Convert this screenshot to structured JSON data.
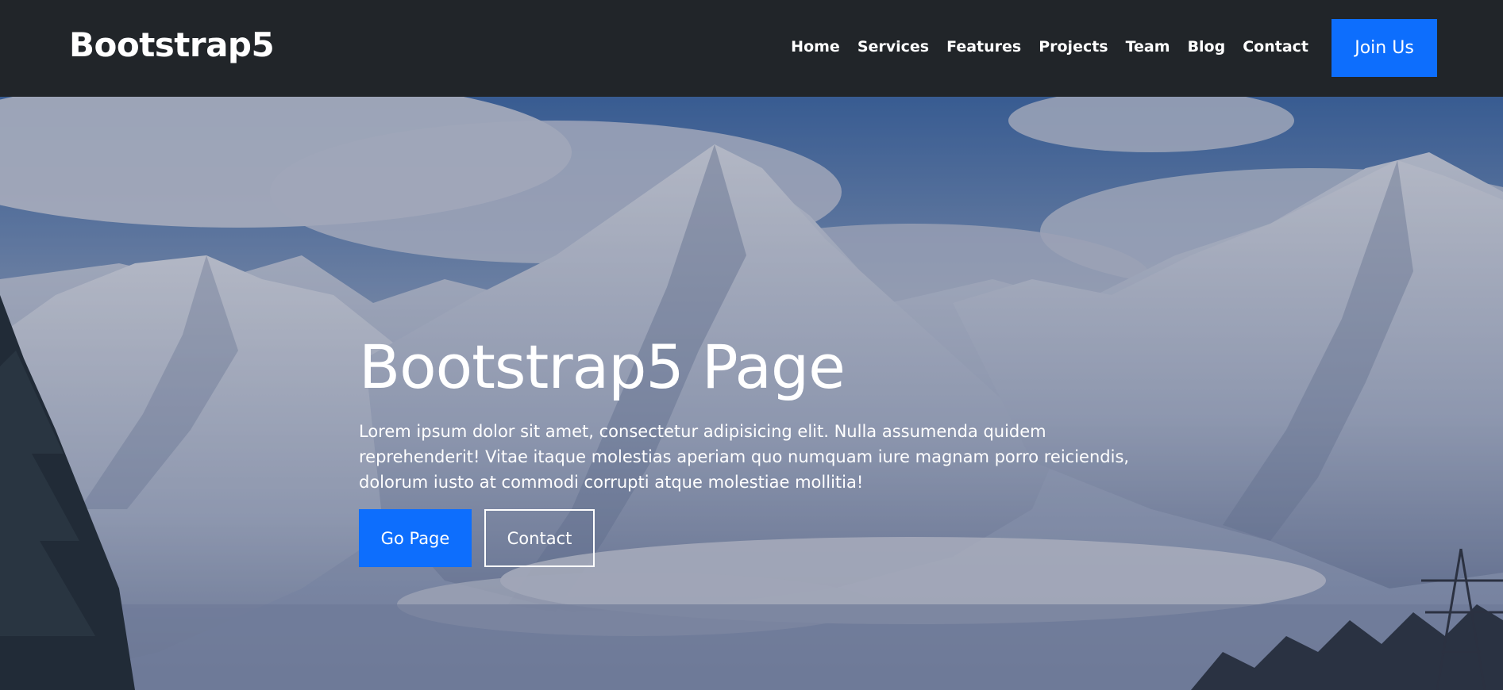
{
  "navbar": {
    "brand": "Bootstrap5",
    "links": [
      "Home",
      "Services",
      "Features",
      "Projects",
      "Team",
      "Blog",
      "Contact"
    ],
    "join_label": "Join Us"
  },
  "hero": {
    "title": "Bootstrap5 Page",
    "text": "Lorem ipsum dolor sit amet, consectetur adipisicing elit. Nulla assumenda quidem reprehenderit! Vitae itaque molestias aperiam quo numquam iure magnam porro reiciendis, dolorum iusto at commodi corrupti atque molestiae mollitia!",
    "primary_button": "Go Page",
    "secondary_button": "Contact"
  },
  "colors": {
    "navbar_bg": "#212529",
    "accent": "#0d6efd",
    "text": "#ffffff"
  }
}
